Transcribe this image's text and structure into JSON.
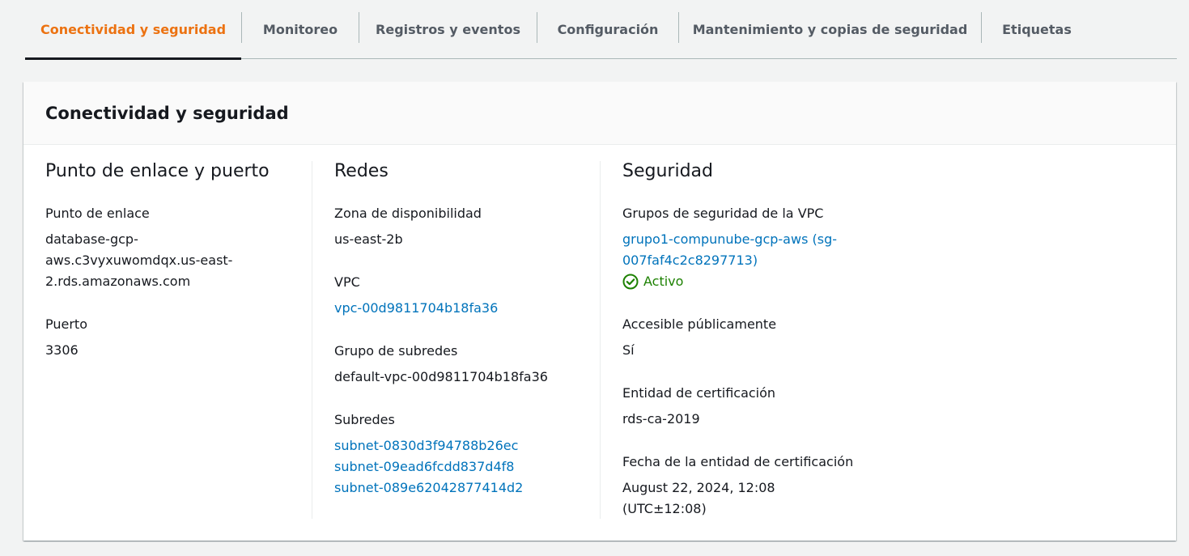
{
  "tabs": [
    {
      "label": "Conectividad y seguridad",
      "active": true
    },
    {
      "label": "Monitoreo"
    },
    {
      "label": "Registros y eventos"
    },
    {
      "label": "Configuración"
    },
    {
      "label": "Mantenimiento y copias de seguridad"
    },
    {
      "label": "Etiquetas"
    }
  ],
  "panel": {
    "title": "Conectividad y seguridad",
    "endpoint_section": {
      "heading": "Punto de enlace y puerto",
      "endpoint_label": "Punto de enlace",
      "endpoint_line1": "database-gcp-",
      "endpoint_line2": "aws.c3vyxuwomdqx.us-east-",
      "endpoint_line3": "2.rds.amazonaws.com",
      "port_label": "Puerto",
      "port_value": "3306"
    },
    "network_section": {
      "heading": "Redes",
      "az_label": "Zona de disponibilidad",
      "az_value": "us-east-2b",
      "vpc_label": "VPC",
      "vpc_value": "vpc-00d9811704b18fa36",
      "subnet_group_label": "Grupo de subredes",
      "subnet_group_value": "default-vpc-00d9811704b18fa36",
      "subnets_label": "Subredes",
      "subnets": [
        "subnet-0830d3f94788b26ec",
        "subnet-09ead6fcdd837d4f8",
        "subnet-089e62042877414d2"
      ]
    },
    "security_section": {
      "heading": "Seguridad",
      "sg_label": "Grupos de seguridad de la VPC",
      "sg_line1": "grupo1-compunube-gcp-aws (sg-",
      "sg_line2": "007faf4c2c8297713)",
      "sg_status": "Activo",
      "public_label": "Accesible públicamente",
      "public_value": "Sí",
      "ca_label": "Entidad de certificación",
      "ca_value": "rds-ca-2019",
      "ca_date_label": "Fecha de la entidad de certificación",
      "ca_date_line1": "August 22, 2024, 12:08",
      "ca_date_line2": "(UTC±12:08)"
    }
  },
  "colors": {
    "accent": "#ec7211",
    "link": "#0073bb",
    "success": "#1d8102"
  }
}
